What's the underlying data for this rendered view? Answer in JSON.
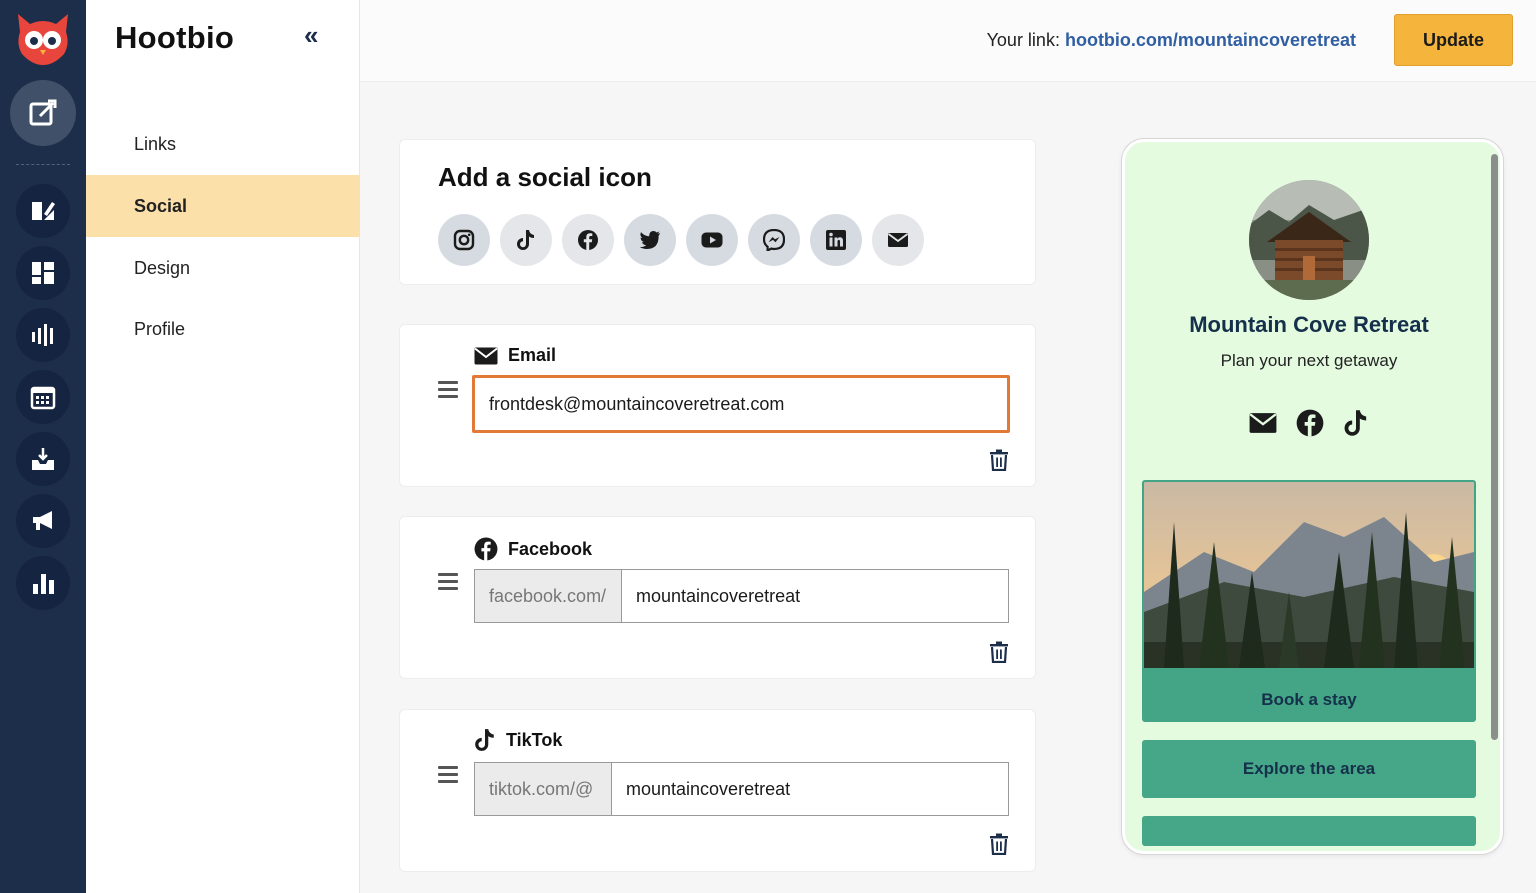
{
  "app": {
    "brand": "Hootbio",
    "collapse_glyph": "«"
  },
  "rail": {
    "icons": [
      "owl-logo-icon",
      "compose-icon",
      "planner-icon",
      "dashboard-icon",
      "streams-icon",
      "calendar-icon",
      "inbox-icon",
      "megaphone-icon",
      "analytics-icon"
    ]
  },
  "nav": {
    "items": [
      {
        "label": "Links"
      },
      {
        "label": "Social"
      },
      {
        "label": "Design"
      },
      {
        "label": "Profile"
      }
    ],
    "active": "Social"
  },
  "topbar": {
    "link_prefix": "Your link: ",
    "link_url": "hootbio.com/mountaincoveretreat",
    "update_label": "Update"
  },
  "add_social": {
    "title": "Add a social icon",
    "icons": [
      "instagram-icon",
      "tiktok-icon",
      "facebook-icon",
      "twitter-icon",
      "youtube-icon",
      "messenger-icon",
      "linkedin-icon",
      "email-icon"
    ]
  },
  "entries": [
    {
      "label": "Email",
      "value": "frontdesk@mountaincoveretreat.com"
    },
    {
      "label": "Facebook",
      "prefix": "facebook.com/",
      "value": "mountaincoveretreat"
    },
    {
      "label": "TikTok",
      "prefix": "tiktok.com/@",
      "value": "mountaincoveretreat"
    }
  ],
  "preview": {
    "name": "Mountain Cove Retreat",
    "tagline": "Plan your next getaway",
    "links": [
      {
        "label": "Book a stay"
      },
      {
        "label": "Explore the area"
      }
    ]
  },
  "colors": {
    "rail": "#1c2e4a",
    "accent": "#f5b53c",
    "active_nav": "#fbe1a9",
    "preview_bg": "#e4fbe0",
    "preview_button": "#46a688",
    "focus_border": "#e07a36",
    "link": "#2f5ea3"
  }
}
